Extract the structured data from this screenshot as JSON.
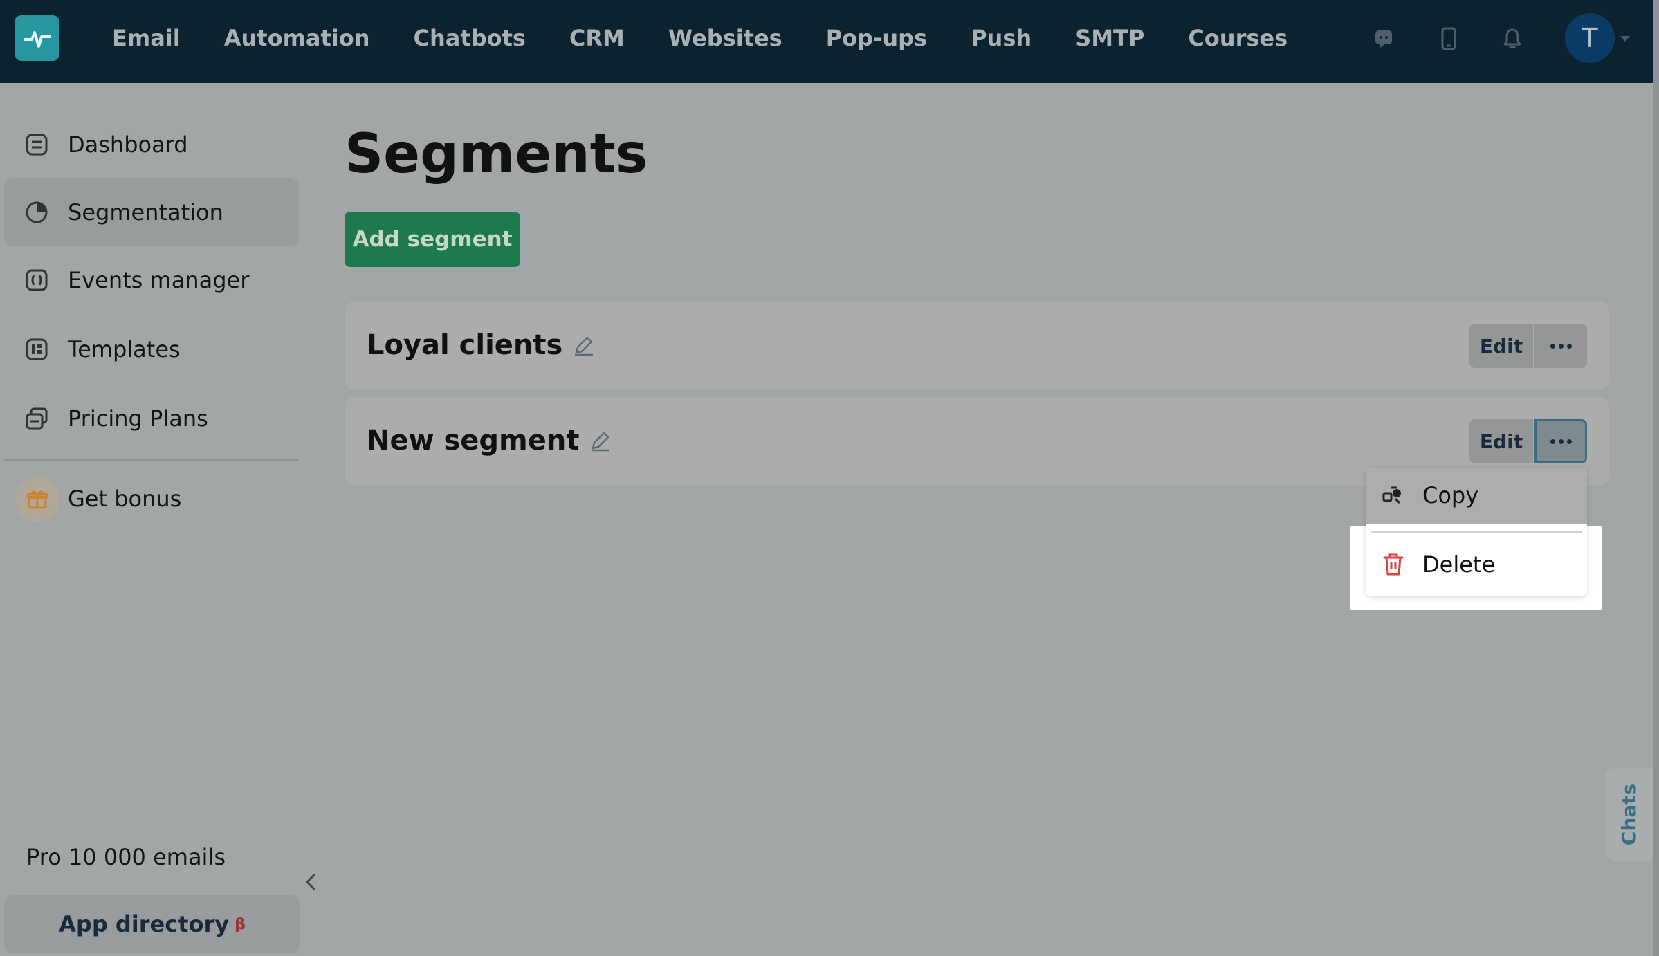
{
  "topbar": {
    "nav": [
      "Email",
      "Automation",
      "Chatbots",
      "CRM",
      "Websites",
      "Pop-ups",
      "Push",
      "SMTP",
      "Courses"
    ],
    "avatar_letter": "T"
  },
  "sidebar": {
    "items": [
      {
        "label": "Dashboard",
        "icon": "dashboard-icon"
      },
      {
        "label": "Segmentation",
        "icon": "segmentation-icon",
        "active": true
      },
      {
        "label": "Events manager",
        "icon": "events-icon"
      },
      {
        "label": "Templates",
        "icon": "templates-icon"
      },
      {
        "label": "Pricing Plans",
        "icon": "pricing-icon"
      }
    ],
    "bonus_label": "Get bonus",
    "plan": "Pro 10 000 emails",
    "app_directory": "App directory",
    "beta": "β"
  },
  "main": {
    "title": "Segments",
    "add_button": "Add segment",
    "segments": [
      {
        "name": "Loyal clients",
        "edit": "Edit"
      },
      {
        "name": "New segment",
        "edit": "Edit"
      }
    ],
    "menu": {
      "copy": "Copy",
      "delete": "Delete"
    }
  },
  "chats_tab": "Chats",
  "colors": {
    "topbar": "#0c222f",
    "accent_green": "#1c7a4d",
    "delete_red": "#e0423a",
    "logo": "#2696a0"
  }
}
